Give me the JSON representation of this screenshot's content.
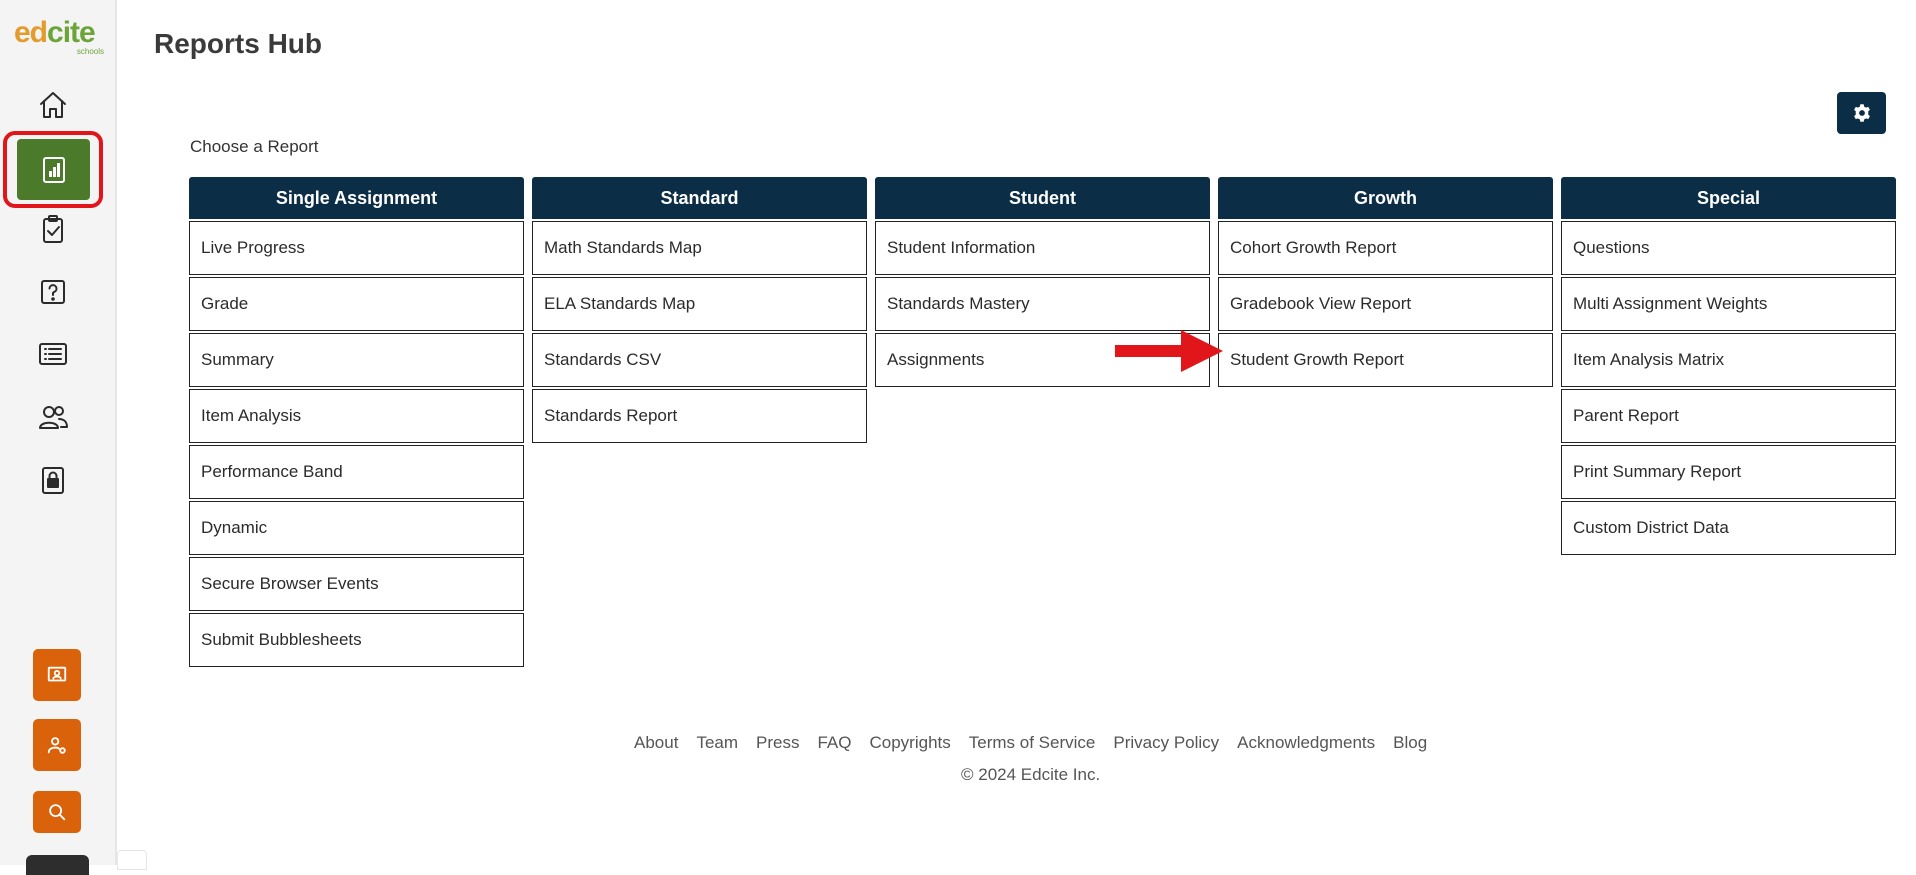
{
  "logo": {
    "word_left": "ed",
    "word_right": "cite",
    "sub": "schools"
  },
  "page": {
    "title": "Reports Hub",
    "choose_label": "Choose a Report"
  },
  "colors": {
    "header_bg": "#0b2d45",
    "active_nav": "#4b7a2a",
    "highlight": "#e0161b",
    "tool_buttons": "#d9620b"
  },
  "sidebar": {
    "nav_icons": [
      "home-icon",
      "reports-icon",
      "clipboard-check-icon",
      "question-icon",
      "list-icon",
      "users-icon",
      "lock-icon"
    ],
    "active": "reports-icon",
    "tools": [
      "presentation-icon",
      "user-settings-icon",
      "search-icon"
    ]
  },
  "columns": [
    {
      "title": "Single Assignment",
      "items": [
        "Live Progress",
        "Grade",
        "Summary",
        "Item Analysis",
        "Performance Band",
        "Dynamic",
        "Secure Browser Events",
        "Submit Bubblesheets"
      ]
    },
    {
      "title": "Standard",
      "items": [
        "Math Standards Map",
        "ELA Standards Map",
        "Standards CSV",
        "Standards Report"
      ]
    },
    {
      "title": "Student",
      "items": [
        "Student Information",
        "Standards Mastery",
        "Assignments"
      ]
    },
    {
      "title": "Growth",
      "items": [
        "Cohort Growth Report",
        "Gradebook View Report",
        "Student Growth Report"
      ]
    },
    {
      "title": "Special",
      "items": [
        "Questions",
        "Multi Assignment Weights",
        "Item Analysis Matrix",
        "Parent Report",
        "Print Summary Report",
        "Custom District Data"
      ]
    }
  ],
  "footer": {
    "links": [
      "About",
      "Team",
      "Press",
      "FAQ",
      "Copyrights",
      "Terms of Service",
      "Privacy Policy",
      "Acknowledgments",
      "Blog"
    ],
    "copyright": "© 2024 Edcite Inc."
  }
}
